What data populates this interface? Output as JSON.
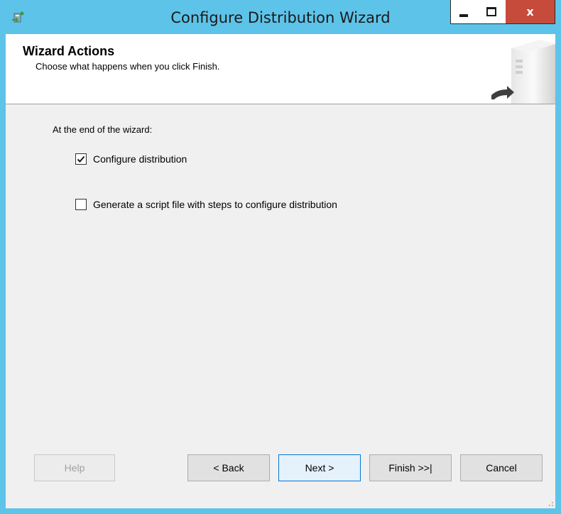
{
  "window": {
    "title": "Configure Distribution Wizard",
    "controls": {
      "close_glyph": "x"
    }
  },
  "header": {
    "title": "Wizard Actions",
    "subtitle": "Choose what happens when you click Finish."
  },
  "main": {
    "lead": "At the end of the wizard:",
    "options": [
      {
        "label": "Configure distribution",
        "checked": true
      },
      {
        "label": "Generate a script file with steps to configure distribution",
        "checked": false
      }
    ]
  },
  "buttons": {
    "help": "Help",
    "back": "< Back",
    "next": "Next >",
    "finish": "Finish >>|",
    "cancel": "Cancel"
  },
  "colors": {
    "frame": "#5ec3e8",
    "close_button": "#c64b3b",
    "default_button_border": "#0078d7"
  },
  "icons": [
    "wizard-app-icon",
    "minimize-icon",
    "maximize-icon",
    "close-icon",
    "server-graphic-icon",
    "checkmark-icon",
    "size-grip-icon"
  ]
}
